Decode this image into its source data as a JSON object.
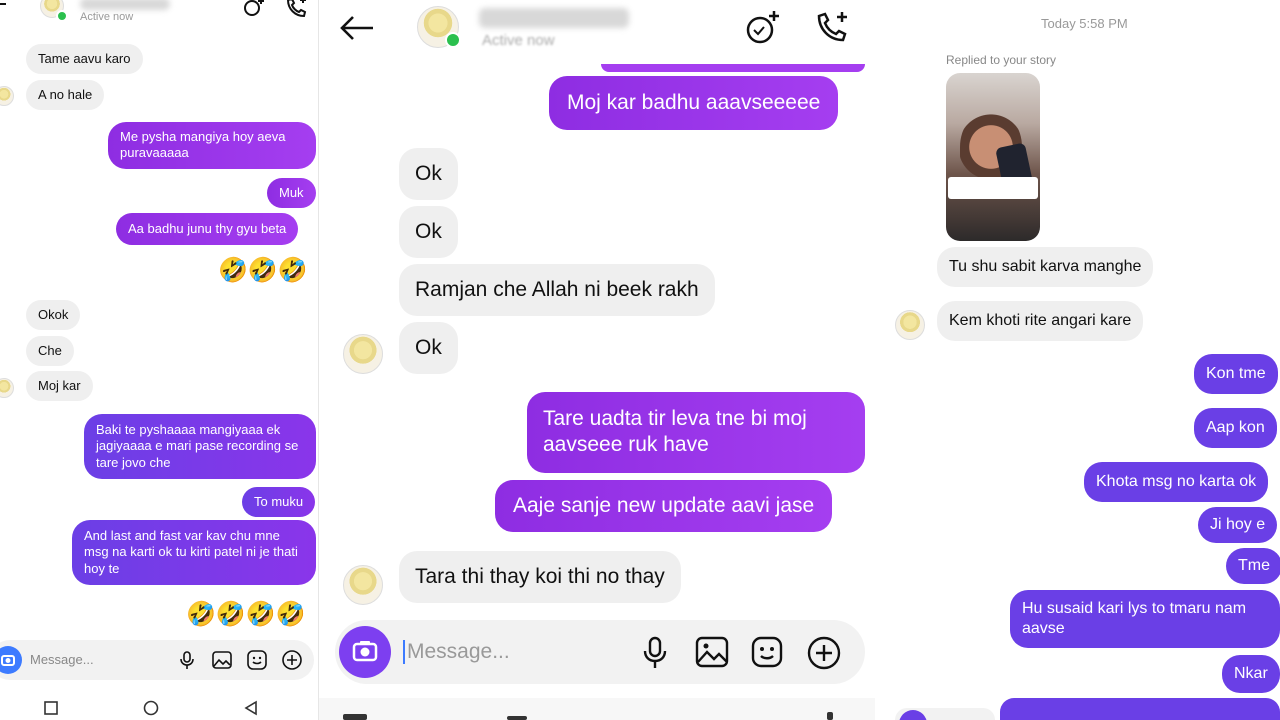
{
  "left": {
    "header_status": "Active now",
    "messages": [
      {
        "text": "Tame aavu karo"
      },
      {
        "text": "A no hale"
      },
      {
        "text": "Me pysha mangiya hoy aeva puravaaaaa"
      },
      {
        "text": "Muk"
      },
      {
        "text": "Aa badhu junu thy gyu beta"
      },
      {
        "text": "🤣🤣🤣"
      },
      {
        "text": "Okok"
      },
      {
        "text": "Che"
      },
      {
        "text": "Moj kar"
      },
      {
        "text": "Baki te pyshaaaa mangiyaaa ek jagiyaaaa e mari pase recording se tare jovo che"
      },
      {
        "text": "To muku"
      },
      {
        "text": "And last and fast var kav chu mne msg na karti ok tu kirti patel ni je thati hoy te"
      },
      {
        "text": "🤣🤣🤣🤣"
      }
    ],
    "composer_placeholder": "Message..."
  },
  "mid": {
    "header_status": "Active now",
    "messages": [
      {
        "text": "Moj kar badhu aaavseeeee"
      },
      {
        "text": "Ok"
      },
      {
        "text": "Ok"
      },
      {
        "text": "Ramjan che Allah ni beek  rakh"
      },
      {
        "text": "Ok"
      },
      {
        "text": "Tare uadta tir leva tne bi moj aavseee ruk have"
      },
      {
        "text": "Aaje sanje new update aavi jase"
      },
      {
        "text": "Tara thi thay koi thi no thay"
      }
    ],
    "composer_placeholder": "Message..."
  },
  "right": {
    "timestamp": "Today 5:58 PM",
    "story_reply_label": "Replied to your story",
    "messages": [
      {
        "text": "Tu shu sabit karva manghe"
      },
      {
        "text": "Kem khoti rite angari kare"
      },
      {
        "text": "Kon tme"
      },
      {
        "text": "Aap kon"
      },
      {
        "text": "Khota msg no karta ok"
      },
      {
        "text": "Ji hoy e"
      },
      {
        "text": "Tme"
      },
      {
        "text": "Hu susaid kari lys to tmaru nam aavse"
      },
      {
        "text": "Nkar"
      }
    ]
  },
  "colors": {
    "outgoing_purple": "#a53ef0",
    "outgoing_violet": "#6a3fe6",
    "incoming_gray": "#efefef",
    "active_green": "#2bc04e"
  },
  "icons": [
    "back-arrow-icon",
    "video-call-icon",
    "phone-call-icon",
    "camera-icon",
    "microphone-icon",
    "gallery-icon",
    "sticker-icon",
    "plus-icon",
    "square-nav-icon",
    "circle-nav-icon",
    "triangle-back-nav-icon"
  ]
}
